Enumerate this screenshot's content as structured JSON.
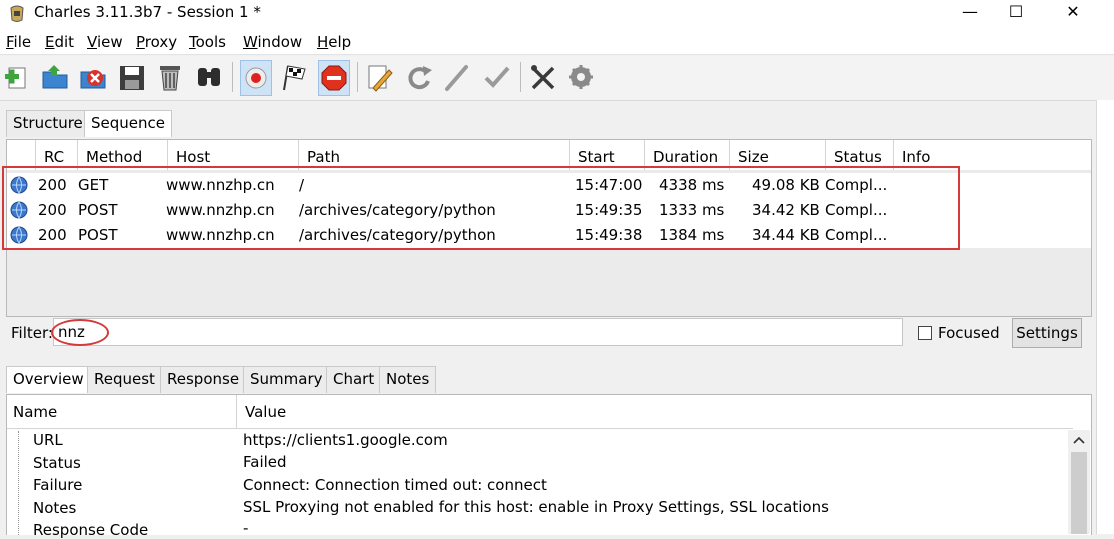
{
  "window": {
    "title": "Charles 3.11.3b7 - Session 1 *",
    "controls": {
      "minimize": "—",
      "maximize": "☐",
      "close": "✕"
    }
  },
  "menu": [
    {
      "label": "File",
      "key": "F",
      "rest": "ile"
    },
    {
      "label": "Edit",
      "key": "E",
      "rest": "dit"
    },
    {
      "label": "View",
      "key": "V",
      "rest": "iew"
    },
    {
      "label": "Proxy",
      "key": "P",
      "rest": "roxy"
    },
    {
      "label": "Tools",
      "key": "T",
      "rest": "ools"
    },
    {
      "label": "Window",
      "key": "W",
      "rest": "indow"
    },
    {
      "label": "Help",
      "key": "H",
      "rest": "elp"
    }
  ],
  "toolbar": [
    "new-session-icon",
    "open-icon",
    "close-session-icon",
    "save-icon",
    "clear-icon",
    "find-icon",
    "record-icon",
    "throttle-icon",
    "breakpoints-icon",
    "compose-icon",
    "repeat-icon",
    "edit-icon",
    "validate-icon",
    "tools-icon",
    "settings-gear-icon"
  ],
  "view_tabs": {
    "structure": "Structure",
    "sequence": "Sequence"
  },
  "columns": {
    "rc": "RC",
    "method": "Method",
    "host": "Host",
    "path": "Path",
    "start": "Start",
    "duration": "Duration",
    "size": "Size",
    "status": "Status",
    "info": "Info"
  },
  "rows": [
    {
      "rc": "200",
      "method": "GET",
      "host": "www.nnzhp.cn",
      "path": "/",
      "start": "15:47:00",
      "duration": "4338 ms",
      "size": "49.08 KB",
      "status": "Compl..."
    },
    {
      "rc": "200",
      "method": "POST",
      "host": "www.nnzhp.cn",
      "path": "/archives/category/python",
      "start": "15:49:35",
      "duration": "1333 ms",
      "size": "34.42 KB",
      "status": "Compl..."
    },
    {
      "rc": "200",
      "method": "POST",
      "host": "www.nnzhp.cn",
      "path": "/archives/category/python",
      "start": "15:49:38",
      "duration": "1384 ms",
      "size": "34.44 KB",
      "status": "Compl..."
    }
  ],
  "filter": {
    "label": "Filter:",
    "value": "nnz",
    "focused_label": "Focused",
    "focused_checked": false,
    "settings_label": "Settings"
  },
  "detail_tabs": [
    "Overview",
    "Request",
    "Response",
    "Summary",
    "Chart",
    "Notes"
  ],
  "detail_columns": {
    "name": "Name",
    "value": "Value"
  },
  "detail_rows": [
    {
      "name": "URL",
      "value": "https://clients1.google.com"
    },
    {
      "name": "Status",
      "value": "Failed"
    },
    {
      "name": "Failure",
      "value": "Connect: Connection timed out: connect"
    },
    {
      "name": "Notes",
      "value": "SSL Proxying not enabled for this host: enable in Proxy Settings, SSL locations"
    },
    {
      "name": "Response Code",
      "value": "-"
    }
  ],
  "colors": {
    "highlight": "#d43a3a",
    "selected_tab": "#ffffff",
    "toolbar_active": "#cfe3f7"
  }
}
